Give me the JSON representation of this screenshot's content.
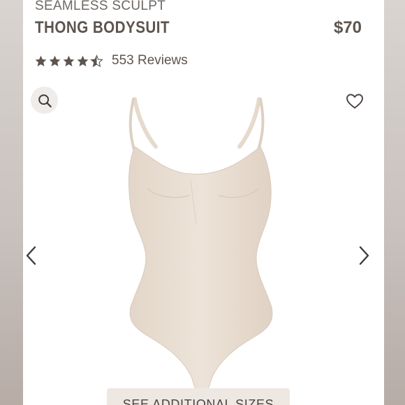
{
  "product": {
    "collection": "SEAMLESS SCULPT",
    "name": "THONG BODYSUIT",
    "price": "$70"
  },
  "rating": {
    "value": 4.5,
    "max": 5,
    "reviews_label": "553 Reviews"
  },
  "buttons": {
    "see_sizes_label": "SEE ADDITIONAL SIZES"
  },
  "icons": {
    "search": "search-icon",
    "wishlist": "heart-outline-icon",
    "prev": "chevron-left-icon",
    "next": "chevron-right-icon",
    "star_full": "star-icon",
    "star_half": "star-half-icon"
  },
  "colors": {
    "text_dark": "#5e544e",
    "text_muted": "#6e6863",
    "product_nude": "#eadfd3",
    "button_bg": "#eee8e3"
  }
}
